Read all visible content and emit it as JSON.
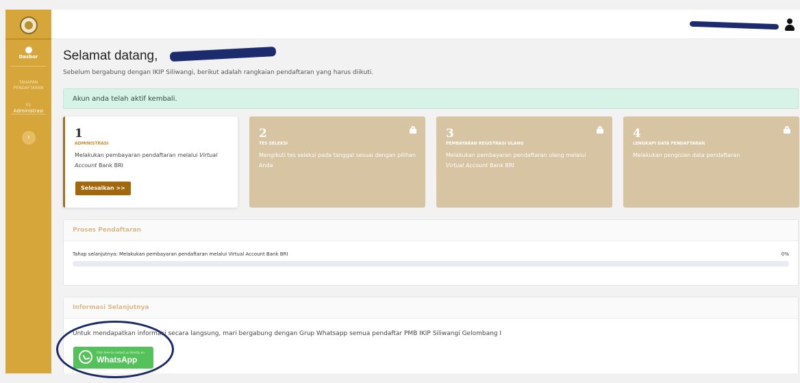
{
  "sidebar": {
    "dasbor_label": "Dasbor",
    "section_label": "TAHAPAN PENDAFTARAN",
    "admin_num": "01",
    "admin_label": "Administrasi",
    "collapse_glyph": "›"
  },
  "main": {
    "welcome": "Selamat datang,",
    "subtitle": "Sebelum bergabung dengan IKIP Siliwangi, berikut adalah rangkaian pendaftaran yang harus diikuti.",
    "alert": "Akun anda telah aktif kembali."
  },
  "steps": [
    {
      "num": "1",
      "title": "ADMINISTRASI",
      "desc_prefix": "Melakukan pembayaran pendaftaran melalui ",
      "desc_em": "Virtual Account",
      "desc_suffix": " Bank BRI",
      "button": "Selesaikan >>"
    },
    {
      "num": "2",
      "title": "TES SELEKSI",
      "desc": "Mengikuti tes seleksi pada tanggal sesuai dengan pilihan Anda"
    },
    {
      "num": "3",
      "title": "PEMBAYARAN REGISTRASI ULANG",
      "desc_prefix": "Melakukan pembayaran pendaftaran ulang melalui ",
      "desc_em": "Virtual Account",
      "desc_suffix": " Bank BRI"
    },
    {
      "num": "4",
      "title": "LENGKAPI DATA PENDAFTARAN",
      "desc": "Melakukan pengisian data pendaftaran"
    }
  ],
  "progress": {
    "header": "Proses Pendaftaran",
    "next_step": "Tahap selanjutnya: Melakukan pembayaran pendaftaran melalui Virtual Account Bank BRI",
    "percent_label": "0%",
    "percent": 0
  },
  "info": {
    "header": "Informasi Selanjutnya",
    "text": "Untuk mendapatkan informasi secara langsung, mari bergabung dengan Grup Whatsapp semua pendaftar PMB IKIP Siliwangi Gelombang I",
    "wa_small": "Click here to contact us directly on",
    "wa_big": "WhatsApp"
  },
  "colors": {
    "accent": "#d6a63a",
    "button": "#a3670c",
    "locked_card": "#d6c4a2",
    "alert_bg": "#d7f2e7"
  }
}
